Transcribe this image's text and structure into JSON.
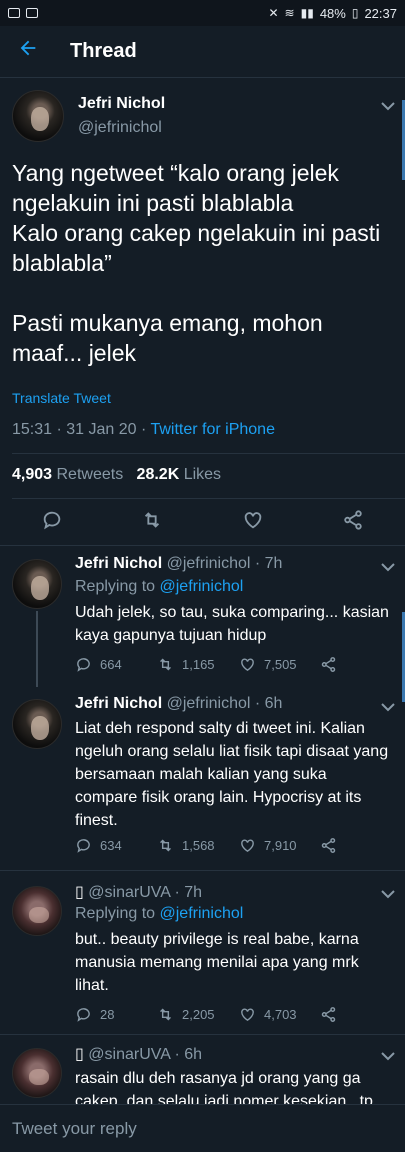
{
  "status_bar": {
    "left_icons": [
      "image-icon",
      "monitor-icon"
    ],
    "battery": "48%",
    "time": "22:37"
  },
  "header": {
    "title": "Thread"
  },
  "main_tweet": {
    "name": "Jefri Nichol",
    "handle": "@jefrinichol",
    "text": "Yang ngetweet “kalo orang jelek ngelakuin ini pasti blablabla\nKalo orang cakep ngelakuin ini pasti blablabla”\n\nPasti mukanya emang, mohon maaf... jelek",
    "translate": "Translate Tweet",
    "time": "15:31 · 31 Jan 20 · ",
    "source": "Twitter for iPhone",
    "retweets_count": "4,903",
    "retweets_label": "Retweets",
    "likes_count": "28.2K",
    "likes_label": "Likes"
  },
  "replies": [
    {
      "name": "Jefri Nichol",
      "handle_time": "@jefrinichol · 7h",
      "replying_prefix": "Replying to ",
      "replying_to": "@jefrinichol",
      "text": "Udah jelek, so tau, suka comparing... kasian kaya gapunya tujuan hidup",
      "replies": "664",
      "retweets": "1,165",
      "likes": "7,505"
    },
    {
      "name": "Jefri Nichol",
      "handle_time": "@jefrinichol · 6h",
      "text": "Liat deh respond salty di tweet ini. Kalian ngeluh orang selalu liat fisik tapi disaat yang bersamaan malah kalian yang suka compare fisik orang lain. Hypocrisy at its finest.",
      "replies": "634",
      "retweets": "1,568",
      "likes": "7,910"
    },
    {
      "name": "▯",
      "handle_time": "@sinarUVA · 7h",
      "replying_prefix": "Replying to ",
      "replying_to": "@jefrinichol",
      "text": "but.. beauty privilege is real babe, karna manusia memang menilai apa yang mrk lihat.",
      "replies": "28",
      "retweets": "2,205",
      "likes": "4,703"
    },
    {
      "name": "▯",
      "handle_time": "@sinarUVA · 6h",
      "text": "rasain dlu deh rasanya jd orang yang ga cakep, dan selalu jadi nomer kesekian.. tp"
    }
  ],
  "reply_bar": {
    "placeholder": "Tweet your reply"
  },
  "colors": {
    "background": "#141d26",
    "accent": "#1da1f2",
    "muted": "#8899a6"
  }
}
